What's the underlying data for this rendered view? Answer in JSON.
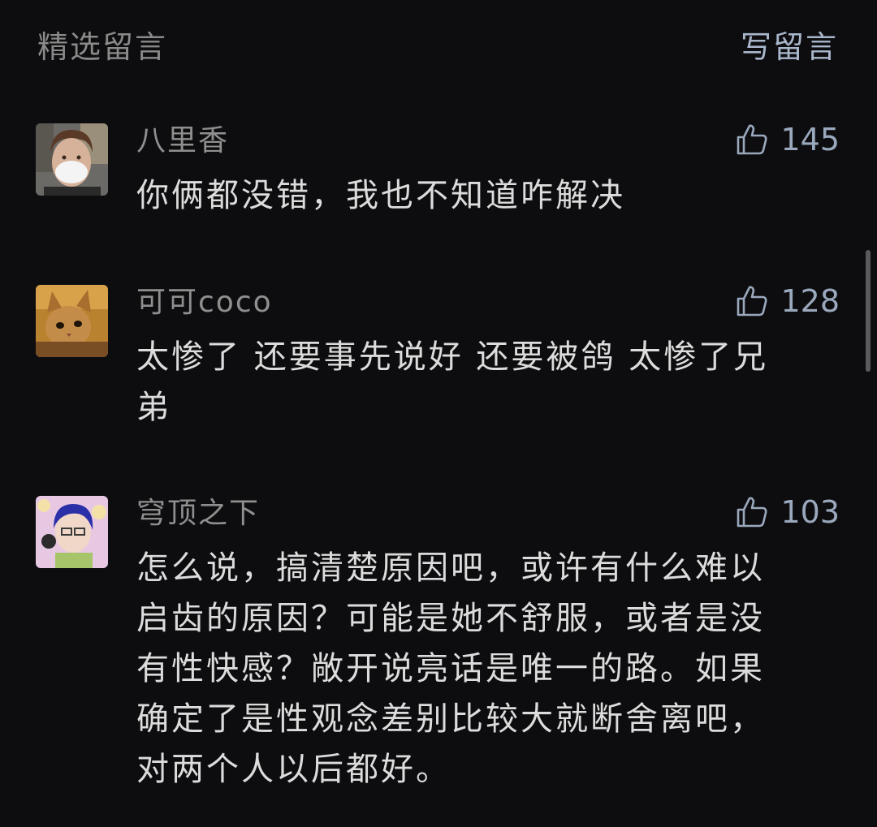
{
  "header": {
    "title": "精选留言",
    "write_label": "写留言"
  },
  "comments": [
    {
      "nickname": "八里香",
      "likes": "145",
      "content": "你俩都没错，我也不知道咋解决"
    },
    {
      "nickname": "可可coco",
      "likes": "128",
      "content": "太惨了 还要事先说好 还要被鸽 太惨了兄\n弟"
    },
    {
      "nickname": "穹顶之下",
      "likes": "103",
      "content": "怎么说，搞清楚原因吧，或许有什么难以\n启齿的原因？可能是她不舒服，或者是没\n有性快感？敞开说亮话是唯一的路。如果\n确定了是性观念差别比较大就断舍离吧，\n对两个人以后都好。"
    }
  ],
  "icons": {
    "like": "thumbs-up-icon"
  },
  "colors": {
    "background": "#0d0d0f",
    "accent": "#a9b7cc"
  }
}
